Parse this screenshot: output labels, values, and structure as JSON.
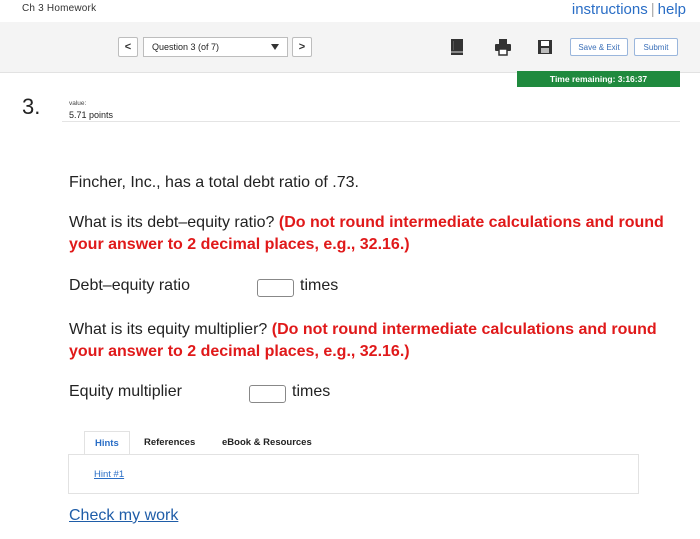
{
  "header": {
    "course_title": "Ch 3 Homework",
    "instructions_link": "instructions",
    "help_link": "help"
  },
  "navigation": {
    "prev_label": "<",
    "next_label": ">",
    "question_select": "Question 3 (of 7)"
  },
  "toolbar": {
    "save_exit_label": "Save & Exit",
    "submit_label": "Submit",
    "icons": [
      "book-icon",
      "print-icon",
      "save-icon"
    ]
  },
  "timer": {
    "text": "Time remaining: 3:16:37",
    "color": "#1f8a3e"
  },
  "question": {
    "number": "3.",
    "value_label": "value:",
    "points": "5.71 points",
    "intro": "Fincher, Inc., has a total debt ratio of .73.",
    "q1_text": "What is its debt–equity ratio?",
    "q1_instruction": "(Do not round intermediate calculations and round your answer to 2 decimal places, e.g., 32.16.)",
    "q1_label": "Debt–equity ratio",
    "q1_value": "",
    "q1_unit": "times",
    "q2_text": "What is its equity multiplier?",
    "q2_instruction": "(Do not round intermediate calculations and round your answer to 2 decimal places, e.g., 32.16.)",
    "q2_label": "Equity multiplier",
    "q2_value": "",
    "q2_unit": "times",
    "instruction_color": "#e0191a"
  },
  "tabs": {
    "hints": "Hints",
    "references": "References",
    "ebook": "eBook & Resources"
  },
  "hints": {
    "link": "Hint #1"
  },
  "footer": {
    "check_work": "Check my work"
  }
}
